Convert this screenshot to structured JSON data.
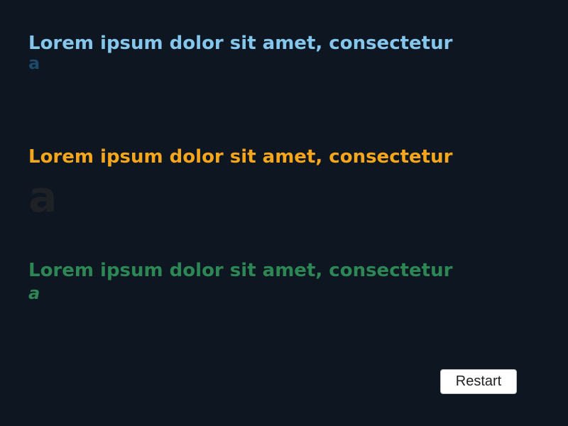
{
  "rows": [
    {
      "text": "Lorem ipsum dolor sit amet, consectetur",
      "trailing": "a",
      "color": "#84c6ec"
    },
    {
      "text": "Lorem ipsum dolor sit amet, consectetur",
      "trailing": "a",
      "color": "#f6a61b"
    },
    {
      "text": "Lorem ipsum dolor sit amet, consectetur",
      "trailing": "a",
      "color": "#2d8754"
    }
  ],
  "controls": {
    "restart_label": "Restart"
  },
  "colors": {
    "background": "#0d1621",
    "button_bg": "#ffffff"
  }
}
